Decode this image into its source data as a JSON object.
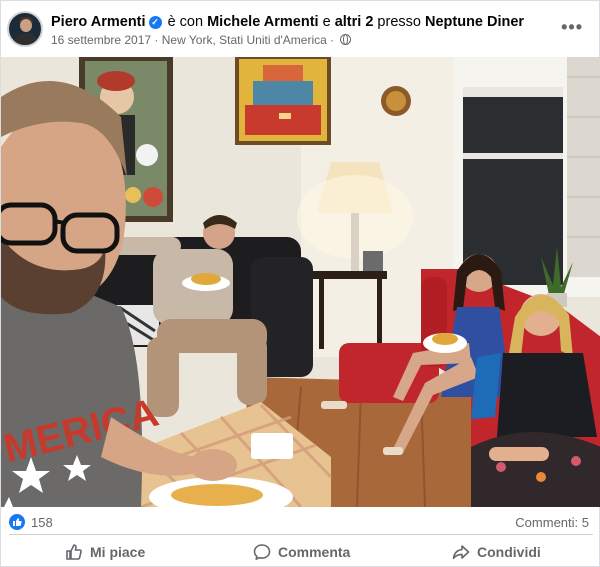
{
  "header": {
    "author": "Piero Armenti",
    "with_text": "è con",
    "tagged_person": "Michele Armenti",
    "and_text": "e",
    "others": "altri 2",
    "at_text": "presso",
    "place": "Neptune Diner",
    "date": "16 settembre 2017",
    "separator": "·",
    "location": "New York, Stati Uniti d'America",
    "separator2": "·",
    "more_label": "•••"
  },
  "photo": {
    "shirt_text": "MERICA"
  },
  "footer": {
    "like_count": "158",
    "comments": "Commenti: 5",
    "actions": {
      "like": "Mi piace",
      "comment": "Commenta",
      "share": "Condividi"
    }
  },
  "colors": {
    "facebook_blue": "#1877f2",
    "secondary_text": "#65676b",
    "sofa_red": "#c0262b"
  }
}
